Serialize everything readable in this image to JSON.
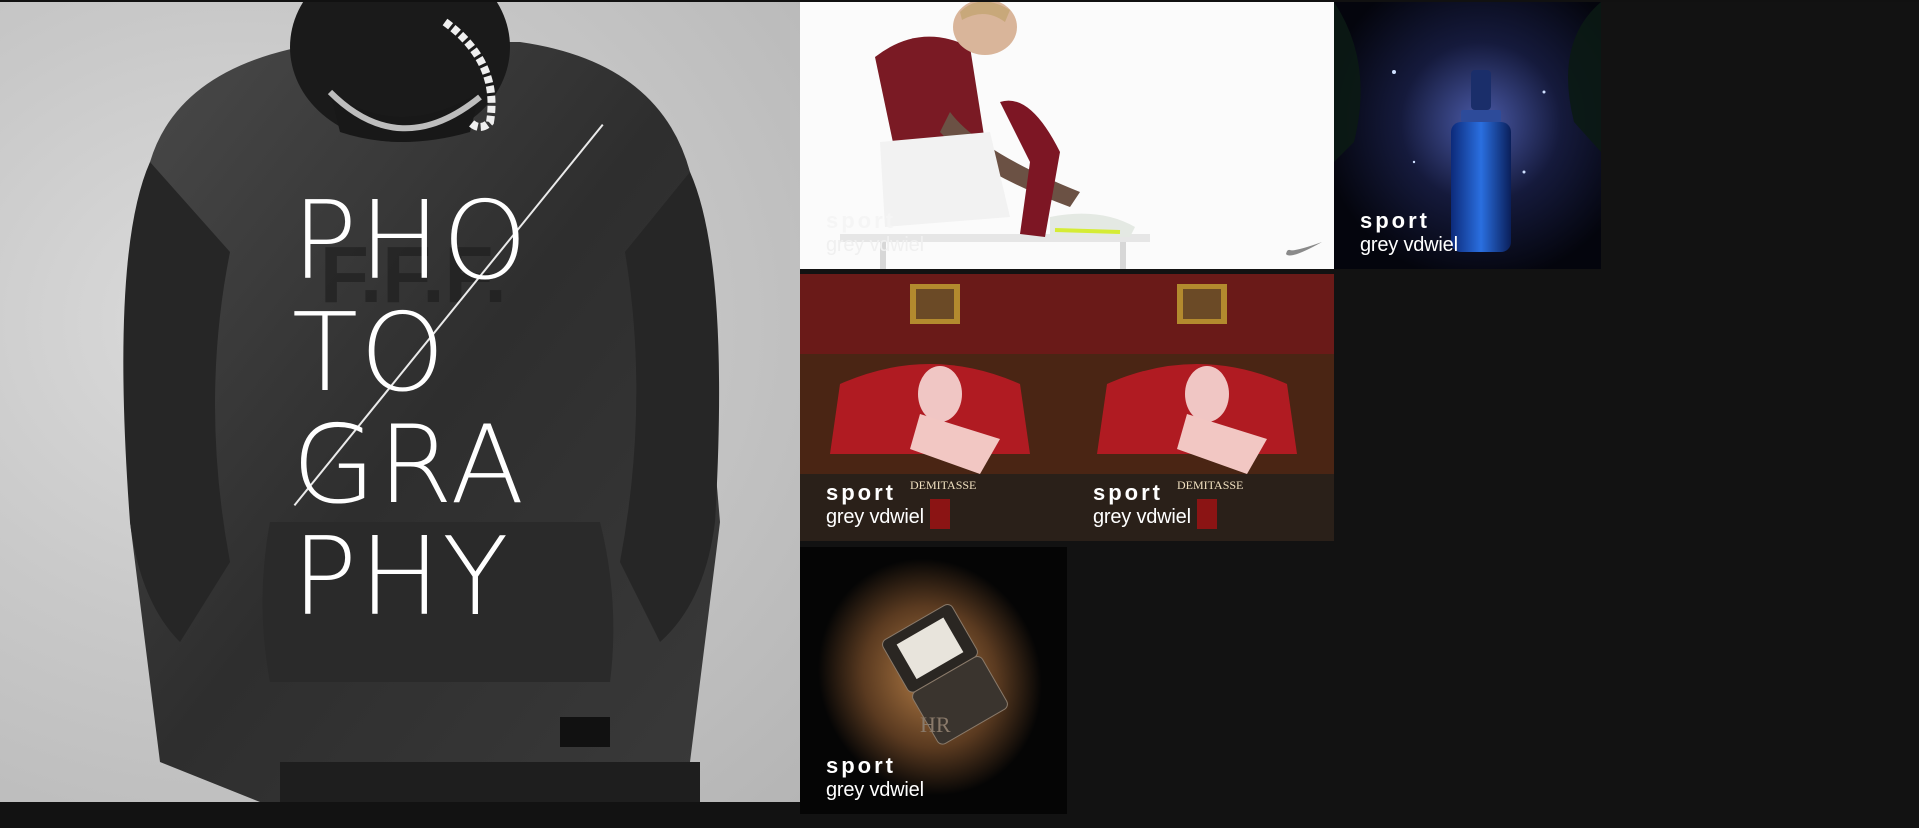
{
  "hero": {
    "title_lines": [
      "PHO",
      "TO",
      "GRA",
      "PHY"
    ]
  },
  "tiles": [
    {
      "category": "sport",
      "name": "grey vdwiel",
      "icon": "swoosh-icon"
    },
    {
      "category": "sport",
      "name": "grey vdwiel"
    },
    {
      "category": "sport",
      "name": "grey vdwiel",
      "brand": "DEMITASSE"
    },
    {
      "category": "sport",
      "name": "grey vdwiel",
      "brand": "DEMITASSE"
    },
    {
      "category": "sport",
      "name": "grey vdwiel",
      "monogram": "HR"
    }
  ]
}
